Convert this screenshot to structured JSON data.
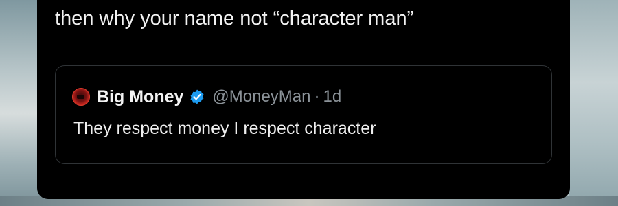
{
  "post": {
    "text": "then why your name not “character man”"
  },
  "quoted_post": {
    "author_name": "Big Money",
    "handle": "@MoneyMan",
    "separator": "·",
    "time": "1d",
    "text": "They respect money I respect character",
    "verified": true
  },
  "colors": {
    "card_background": "#000000",
    "primary_text": "#f2f2f2",
    "secondary_text": "#8b9298",
    "verified_badge": "#1d9bf0",
    "quote_border": "#2f3336"
  },
  "icons": {
    "verified": "verified-badge-icon",
    "avatar": "avatar"
  }
}
